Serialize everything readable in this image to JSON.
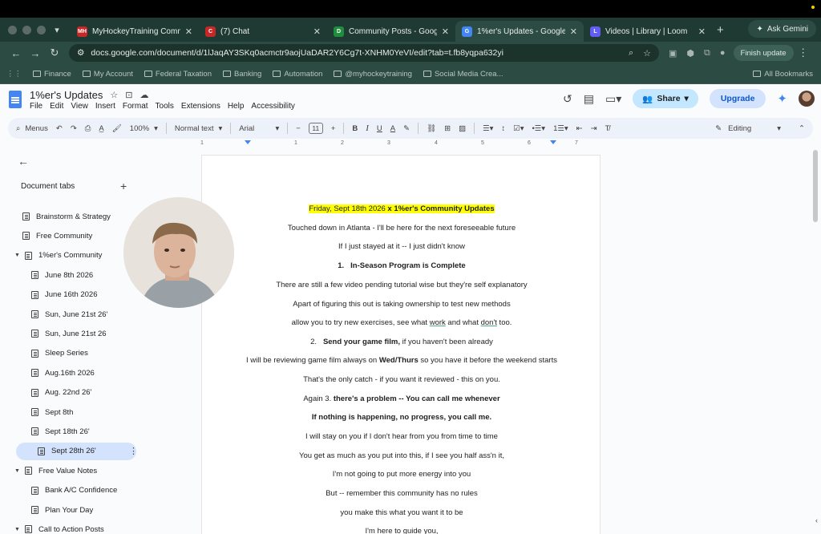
{
  "browser": {
    "tabs": [
      {
        "title": "MyHockeyTraining Community",
        "favicon": "MH",
        "color": "#c62828",
        "active": false
      },
      {
        "title": "(7) Chat",
        "favicon": "C",
        "color": "#c62828",
        "active": false
      },
      {
        "title": "Community Posts - Google Drive",
        "favicon": "D",
        "color": "#1e8e3e",
        "active": false
      },
      {
        "title": "1%er's Updates - Google Docs",
        "favicon": "G",
        "color": "#4285f4",
        "active": true
      },
      {
        "title": "Videos | Library | Loom",
        "favicon": "L",
        "color": "#625df5",
        "active": false
      }
    ],
    "gemini_label": "Ask Gemini",
    "url": "docs.google.com/document/d/1lJaqAY3SKq0acmctr9aojUaDAR2Y6Cg7t-XNHM0YeVI/edit?tab=t.fb8yqpa632yi",
    "finish_update": "Finish update",
    "bookmarks": [
      "Finance",
      "My Account",
      "Federal Taxation",
      "Banking",
      "Automation",
      "@myhockeytraining",
      "Social Media Crea..."
    ],
    "all_bookmarks": "All Bookmarks"
  },
  "doc": {
    "title": "1%er's Updates",
    "menu": [
      "File",
      "Edit",
      "View",
      "Insert",
      "Format",
      "Tools",
      "Extensions",
      "Help",
      "Accessibility"
    ],
    "share_label": "Share",
    "upgrade_label": "Upgrade",
    "toolbar": {
      "menus": "Menus",
      "zoom": "100%",
      "style": "Normal text",
      "font": "Arial",
      "size": "11",
      "mode": "Editing"
    },
    "ruler": [
      "1",
      "1",
      "2",
      "3",
      "4",
      "5",
      "6",
      "7"
    ]
  },
  "sidebar": {
    "heading": "Document tabs",
    "items": [
      {
        "label": "Brainstorm & Strategy",
        "level": 0,
        "caret": false
      },
      {
        "label": "Free Community",
        "level": 0,
        "caret": false
      },
      {
        "label": "1%er's Community",
        "level": 0,
        "caret": true
      },
      {
        "label": "June 8th 2026",
        "level": 1
      },
      {
        "label": "June 16th 2026",
        "level": 1
      },
      {
        "label": "Sun, June 21st 26'",
        "level": 1
      },
      {
        "label": "Sun, June 21st 26",
        "level": 1
      },
      {
        "label": "Sleep Series",
        "level": 1
      },
      {
        "label": "Aug.16th 2026",
        "level": 1
      },
      {
        "label": "Aug. 22nd 26'",
        "level": 1
      },
      {
        "label": "Sept 8th",
        "level": 1
      },
      {
        "label": "Sept 18th 26'",
        "level": 1
      },
      {
        "label": "Sept 28th 26'",
        "level": 1,
        "active": true
      },
      {
        "label": "Free Value Notes",
        "level": 0,
        "caret": true
      },
      {
        "label": "Bank A/C Confidence",
        "level": 1
      },
      {
        "label": "Plan Your Day",
        "level": 1
      },
      {
        "label": "Call to Action Posts",
        "level": 0,
        "caret": true
      }
    ]
  },
  "content": {
    "header": "Friday, Sept 18th 2026",
    "header_bold": " x 1%er's Community Updates",
    "p1": "Touched down in Atlanta - I'll be here for the next foreseeable future",
    "p2": "If I just stayed at it -- I just didn't know",
    "h1_num": "1.",
    "h1": "In-Season Program is Complete",
    "p3": "There are still a few video pending tutorial wise but they're self explanatory",
    "p4": "Apart of figuring this out is taking ownership to test new methods",
    "p5a": "allow you to try new exercises, see what ",
    "p5b": "work",
    "p5c": " and what ",
    "p5d": "don't",
    "p5e": " too.",
    "h2_num": "2.",
    "h2": "Send your game film,",
    "h2_tail": " if you haven't been already",
    "p6a": "I will be reviewing game film always on ",
    "p6b": "Wed/Thurs",
    "p6c": " so you have it before the weekend starts",
    "p7": "That's the only catch - if you want it reviewed - this on you.",
    "p8a": "Again 3. ",
    "p8b": "there's a problem -- You can call me whenever",
    "p9": "If nothing is happening, no progress, you call me.",
    "p10": "I will stay on you if I don't hear from you from time to time",
    "p11": "You get as much as you put into this, if I see you half ass'n it,",
    "p12": "I'm not going to put more energy into you",
    "p13": "But -- remember this community has no rules",
    "p14": "you make this what you want it to be",
    "p15": "I'm here to guide you,"
  }
}
